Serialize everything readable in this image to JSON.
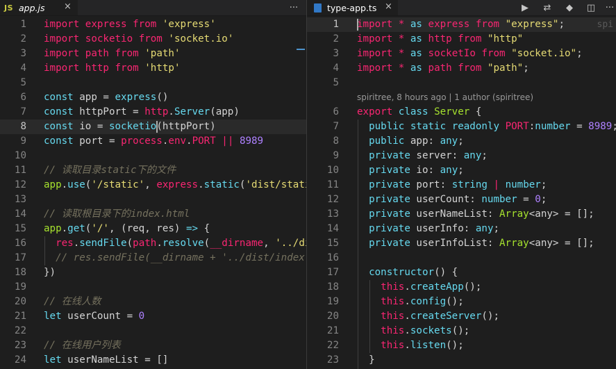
{
  "left_editor": {
    "tab": {
      "icon_label": "JS",
      "title": "app.js",
      "close": "×"
    },
    "actions_more": "···",
    "lines": [
      {
        "n": "1",
        "parts": [
          [
            "k",
            "import"
          ],
          [
            "v",
            " "
          ],
          [
            "k",
            "express"
          ],
          [
            "v",
            " "
          ],
          [
            "k",
            "from"
          ],
          [
            "v",
            " "
          ],
          [
            "s",
            "'express'"
          ]
        ]
      },
      {
        "n": "2",
        "parts": [
          [
            "k",
            "import"
          ],
          [
            "v",
            " "
          ],
          [
            "k",
            "socketio"
          ],
          [
            "v",
            " "
          ],
          [
            "k",
            "from"
          ],
          [
            "v",
            " "
          ],
          [
            "s",
            "'socket.io'"
          ]
        ]
      },
      {
        "n": "3",
        "parts": [
          [
            "k",
            "import"
          ],
          [
            "v",
            " "
          ],
          [
            "k",
            "path"
          ],
          [
            "v",
            " "
          ],
          [
            "k",
            "from"
          ],
          [
            "v",
            " "
          ],
          [
            "s",
            "'path'"
          ]
        ]
      },
      {
        "n": "4",
        "parts": [
          [
            "k",
            "import"
          ],
          [
            "v",
            " "
          ],
          [
            "k",
            "http"
          ],
          [
            "v",
            " "
          ],
          [
            "k",
            "from"
          ],
          [
            "v",
            " "
          ],
          [
            "s",
            "'http'"
          ]
        ]
      },
      {
        "n": "5",
        "parts": []
      },
      {
        "n": "6",
        "parts": [
          [
            "kb",
            "const"
          ],
          [
            "v",
            " app = "
          ],
          [
            "f",
            "express"
          ],
          [
            "v",
            "()"
          ]
        ]
      },
      {
        "n": "7",
        "parts": [
          [
            "kb",
            "const"
          ],
          [
            "v",
            " httpPort = "
          ],
          [
            "k",
            "http"
          ],
          [
            "v",
            "."
          ],
          [
            "f",
            "Server"
          ],
          [
            "v",
            "(app)"
          ]
        ]
      },
      {
        "n": "8",
        "parts": [
          [
            "kb",
            "const"
          ],
          [
            "v",
            " io = "
          ],
          [
            "f",
            "socketio"
          ],
          [
            "v",
            "(httpPort)"
          ]
        ]
      },
      {
        "n": "9",
        "parts": [
          [
            "kb",
            "const"
          ],
          [
            "v",
            " port = "
          ],
          [
            "k",
            "process"
          ],
          [
            "v",
            "."
          ],
          [
            "k",
            "env"
          ],
          [
            "v",
            "."
          ],
          [
            "k",
            "PORT"
          ],
          [
            "v",
            " "
          ],
          [
            "op",
            "||"
          ],
          [
            "v",
            " "
          ],
          [
            "n",
            "8989"
          ]
        ]
      },
      {
        "n": "10",
        "parts": []
      },
      {
        "n": "11",
        "parts": [
          [
            "c",
            "// 读取目录static下的文件"
          ]
        ]
      },
      {
        "n": "12",
        "parts": [
          [
            "t",
            "app"
          ],
          [
            "v",
            "."
          ],
          [
            "f",
            "use"
          ],
          [
            "v",
            "("
          ],
          [
            "s",
            "'/static'"
          ],
          [
            "v",
            ", "
          ],
          [
            "k",
            "express"
          ],
          [
            "v",
            "."
          ],
          [
            "f",
            "static"
          ],
          [
            "v",
            "("
          ],
          [
            "s",
            "'dist/stati"
          ]
        ]
      },
      {
        "n": "13",
        "parts": []
      },
      {
        "n": "14",
        "parts": [
          [
            "c",
            "// 读取根目录下的index.html"
          ]
        ]
      },
      {
        "n": "15",
        "parts": [
          [
            "t",
            "app"
          ],
          [
            "v",
            "."
          ],
          [
            "f",
            "get"
          ],
          [
            "v",
            "("
          ],
          [
            "s",
            "'/'"
          ],
          [
            "v",
            ", (req, res) "
          ],
          [
            "kb",
            "=>"
          ],
          [
            "v",
            " {"
          ]
        ]
      },
      {
        "n": "16",
        "parts": [
          [
            "v",
            "  "
          ],
          [
            "k",
            "res"
          ],
          [
            "v",
            "."
          ],
          [
            "f",
            "sendFile"
          ],
          [
            "v",
            "("
          ],
          [
            "k",
            "path"
          ],
          [
            "v",
            "."
          ],
          [
            "f",
            "resolve"
          ],
          [
            "v",
            "("
          ],
          [
            "k",
            "__dirname"
          ],
          [
            "v",
            ", "
          ],
          [
            "s",
            "'../di"
          ]
        ]
      },
      {
        "n": "17",
        "parts": [
          [
            "v",
            "  "
          ],
          [
            "c",
            "// res.sendFile(__dirname + '../dist/index."
          ]
        ]
      },
      {
        "n": "18",
        "parts": [
          [
            "v",
            "})"
          ]
        ]
      },
      {
        "n": "19",
        "parts": []
      },
      {
        "n": "20",
        "parts": [
          [
            "c",
            "// 在线人数"
          ]
        ]
      },
      {
        "n": "21",
        "parts": [
          [
            "kb",
            "let"
          ],
          [
            "v",
            " userCount = "
          ],
          [
            "n",
            "0"
          ]
        ]
      },
      {
        "n": "22",
        "parts": []
      },
      {
        "n": "23",
        "parts": [
          [
            "c",
            "// 在线用户列表"
          ]
        ]
      },
      {
        "n": "24",
        "parts": [
          [
            "kb",
            "let"
          ],
          [
            "v",
            " userNameList = []"
          ]
        ]
      }
    ]
  },
  "right_editor": {
    "tab": {
      "title": "type-app.ts",
      "close": "×"
    },
    "toolbar": {
      "run": "▶",
      "compare": "⇄",
      "git": "◆",
      "split": "◫",
      "more": "···"
    },
    "codelens": "spiritree, 8 hours ago | 1 author (spiritree)",
    "ghost_blame": "spi",
    "lines": [
      {
        "n": "1",
        "parts": [
          [
            "k",
            "import"
          ],
          [
            "v",
            " "
          ],
          [
            "k",
            "*"
          ],
          [
            "v",
            " "
          ],
          [
            "kb",
            "as"
          ],
          [
            "v",
            " "
          ],
          [
            "k",
            "express"
          ],
          [
            "v",
            " "
          ],
          [
            "k",
            "from"
          ],
          [
            "v",
            " "
          ],
          [
            "s",
            "\"express\""
          ],
          [
            "v",
            ";"
          ]
        ]
      },
      {
        "n": "2",
        "parts": [
          [
            "k",
            "import"
          ],
          [
            "v",
            " "
          ],
          [
            "k",
            "*"
          ],
          [
            "v",
            " "
          ],
          [
            "kb",
            "as"
          ],
          [
            "v",
            " "
          ],
          [
            "k",
            "http"
          ],
          [
            "v",
            " "
          ],
          [
            "k",
            "from"
          ],
          [
            "v",
            " "
          ],
          [
            "s",
            "\"http\""
          ]
        ]
      },
      {
        "n": "3",
        "parts": [
          [
            "k",
            "import"
          ],
          [
            "v",
            " "
          ],
          [
            "k",
            "*"
          ],
          [
            "v",
            " "
          ],
          [
            "kb",
            "as"
          ],
          [
            "v",
            " "
          ],
          [
            "k",
            "socketIo"
          ],
          [
            "v",
            " "
          ],
          [
            "k",
            "from"
          ],
          [
            "v",
            " "
          ],
          [
            "s",
            "\"socket.io\""
          ],
          [
            "v",
            ";"
          ]
        ]
      },
      {
        "n": "4",
        "parts": [
          [
            "k",
            "import"
          ],
          [
            "v",
            " "
          ],
          [
            "k",
            "*"
          ],
          [
            "v",
            " "
          ],
          [
            "kb",
            "as"
          ],
          [
            "v",
            " "
          ],
          [
            "k",
            "path"
          ],
          [
            "v",
            " "
          ],
          [
            "k",
            "from"
          ],
          [
            "v",
            " "
          ],
          [
            "s",
            "\"path\""
          ],
          [
            "v",
            ";"
          ]
        ]
      },
      {
        "n": "5",
        "parts": []
      },
      {
        "n": "6",
        "parts": [
          [
            "k",
            "export"
          ],
          [
            "v",
            " "
          ],
          [
            "kb",
            "class"
          ],
          [
            "v",
            " "
          ],
          [
            "t",
            "Server"
          ],
          [
            "v",
            " {"
          ]
        ]
      },
      {
        "n": "7",
        "parts": [
          [
            "v",
            "  "
          ],
          [
            "kb",
            "public"
          ],
          [
            "v",
            " "
          ],
          [
            "kb",
            "static"
          ],
          [
            "v",
            " "
          ],
          [
            "kb",
            "readonly"
          ],
          [
            "v",
            " "
          ],
          [
            "k",
            "PORT"
          ],
          [
            "v",
            ":"
          ],
          [
            "kb",
            "number"
          ],
          [
            "v",
            " = "
          ],
          [
            "n",
            "8989"
          ],
          [
            "v",
            ";"
          ]
        ]
      },
      {
        "n": "8",
        "parts": [
          [
            "v",
            "  "
          ],
          [
            "kb",
            "public"
          ],
          [
            "v",
            " app: "
          ],
          [
            "kb",
            "any"
          ],
          [
            "v",
            ";"
          ]
        ]
      },
      {
        "n": "9",
        "parts": [
          [
            "v",
            "  "
          ],
          [
            "kb",
            "private"
          ],
          [
            "v",
            " server: "
          ],
          [
            "kb",
            "any"
          ],
          [
            "v",
            ";"
          ]
        ]
      },
      {
        "n": "10",
        "parts": [
          [
            "v",
            "  "
          ],
          [
            "kb",
            "private"
          ],
          [
            "v",
            " io: "
          ],
          [
            "kb",
            "any"
          ],
          [
            "v",
            ";"
          ]
        ]
      },
      {
        "n": "11",
        "parts": [
          [
            "v",
            "  "
          ],
          [
            "kb",
            "private"
          ],
          [
            "v",
            " port: "
          ],
          [
            "kb",
            "string"
          ],
          [
            "v",
            " "
          ],
          [
            "op",
            "|"
          ],
          [
            "v",
            " "
          ],
          [
            "kb",
            "number"
          ],
          [
            "v",
            ";"
          ]
        ]
      },
      {
        "n": "12",
        "parts": [
          [
            "v",
            "  "
          ],
          [
            "kb",
            "private"
          ],
          [
            "v",
            " userCount: "
          ],
          [
            "kb",
            "number"
          ],
          [
            "v",
            " = "
          ],
          [
            "n",
            "0"
          ],
          [
            "v",
            ";"
          ]
        ]
      },
      {
        "n": "13",
        "parts": [
          [
            "v",
            "  "
          ],
          [
            "kb",
            "private"
          ],
          [
            "v",
            " userNameList: "
          ],
          [
            "t",
            "Array"
          ],
          [
            "v",
            "<any> = [];"
          ]
        ]
      },
      {
        "n": "14",
        "parts": [
          [
            "v",
            "  "
          ],
          [
            "kb",
            "private"
          ],
          [
            "v",
            " userInfo: "
          ],
          [
            "kb",
            "any"
          ],
          [
            "v",
            ";"
          ]
        ]
      },
      {
        "n": "15",
        "parts": [
          [
            "v",
            "  "
          ],
          [
            "kb",
            "private"
          ],
          [
            "v",
            " userInfoList: "
          ],
          [
            "t",
            "Array"
          ],
          [
            "v",
            "<any> = [];"
          ]
        ]
      },
      {
        "n": "16",
        "parts": []
      },
      {
        "n": "17",
        "parts": [
          [
            "v",
            "  "
          ],
          [
            "kb",
            "constructor"
          ],
          [
            "v",
            "() {"
          ]
        ]
      },
      {
        "n": "18",
        "parts": [
          [
            "v",
            "    "
          ],
          [
            "this",
            "this"
          ],
          [
            "v",
            "."
          ],
          [
            "f",
            "createApp"
          ],
          [
            "v",
            "();"
          ]
        ]
      },
      {
        "n": "19",
        "parts": [
          [
            "v",
            "    "
          ],
          [
            "this",
            "this"
          ],
          [
            "v",
            "."
          ],
          [
            "f",
            "config"
          ],
          [
            "v",
            "();"
          ]
        ]
      },
      {
        "n": "20",
        "parts": [
          [
            "v",
            "    "
          ],
          [
            "this",
            "this"
          ],
          [
            "v",
            "."
          ],
          [
            "f",
            "createServer"
          ],
          [
            "v",
            "();"
          ]
        ]
      },
      {
        "n": "21",
        "parts": [
          [
            "v",
            "    "
          ],
          [
            "this",
            "this"
          ],
          [
            "v",
            "."
          ],
          [
            "f",
            "sockets"
          ],
          [
            "v",
            "();"
          ]
        ]
      },
      {
        "n": "22",
        "parts": [
          [
            "v",
            "    "
          ],
          [
            "this",
            "this"
          ],
          [
            "v",
            "."
          ],
          [
            "f",
            "listen"
          ],
          [
            "v",
            "();"
          ]
        ]
      },
      {
        "n": "23",
        "parts": [
          [
            "v",
            "  }"
          ]
        ]
      }
    ]
  },
  "colors": {
    "background": "#1e1e1e",
    "keyword_pink": "#f92672",
    "keyword_blue": "#66d9ef",
    "string_yellow": "#e6db74",
    "number_purple": "#ae81ff",
    "comment_gray": "#75715e",
    "type_green": "#a6e22e"
  }
}
